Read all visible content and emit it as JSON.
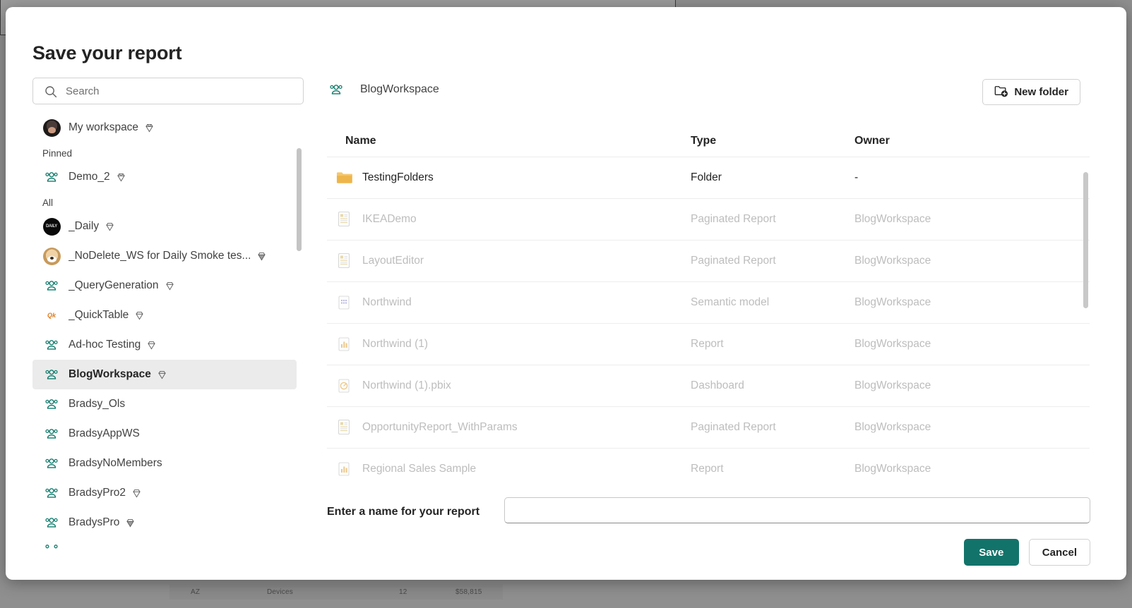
{
  "background": {
    "row_cells": [
      "AZ",
      "Devices",
      "12",
      "$58,815"
    ]
  },
  "dialog": {
    "title": "Save your report"
  },
  "search": {
    "placeholder": "Search",
    "value": "",
    "icon": "search-icon"
  },
  "sidebar": {
    "my_workspace": {
      "label": "My workspace",
      "icon": "avatar-person",
      "badge": "gem-icon"
    },
    "groups": [
      {
        "label": "Pinned",
        "items": [
          {
            "label": "Demo_2",
            "icon": "workspace-group-icon",
            "badge": "gem-icon",
            "selected": false
          }
        ]
      },
      {
        "label": "All",
        "items": [
          {
            "label": "_Daily",
            "icon": "avatar-black",
            "badge": "gem-icon",
            "selected": false
          },
          {
            "label": "_NoDelete_WS for Daily Smoke tes...",
            "icon": "avatar-dog",
            "badge": "gem-dark-icon",
            "selected": false
          },
          {
            "label": "_QueryGeneration",
            "icon": "workspace-group-icon",
            "badge": "gem-icon",
            "selected": false
          },
          {
            "label": "_QuickTable",
            "icon": "avatar-quick",
            "badge": "gem-icon",
            "selected": false
          },
          {
            "label": "Ad-hoc Testing",
            "icon": "workspace-group-icon",
            "badge": "gem-icon",
            "selected": false
          },
          {
            "label": "BlogWorkspace",
            "icon": "workspace-group-icon",
            "badge": "gem-icon",
            "selected": true
          },
          {
            "label": "Bradsy_Ols",
            "icon": "workspace-group-icon",
            "badge": "",
            "selected": false
          },
          {
            "label": "BradsyAppWS",
            "icon": "workspace-group-icon",
            "badge": "",
            "selected": false
          },
          {
            "label": "BradsyNoMembers",
            "icon": "workspace-group-icon",
            "badge": "",
            "selected": false
          },
          {
            "label": "BradsyPro2",
            "icon": "workspace-group-icon",
            "badge": "gem-icon",
            "selected": false
          },
          {
            "label": "BradysPro",
            "icon": "workspace-group-icon",
            "badge": "gem-dark-icon",
            "selected": false
          }
        ]
      }
    ]
  },
  "content": {
    "breadcrumb": {
      "label": "BlogWorkspace",
      "icon": "workspace-group-icon"
    },
    "new_folder_button": {
      "label": "New folder",
      "icon": "new-folder-icon"
    },
    "columns": [
      "Name",
      "Type",
      "Owner"
    ],
    "rows": [
      {
        "name": "TestingFolders",
        "type": "Folder",
        "owner": "-",
        "icon": "folder-icon",
        "disabled": false
      },
      {
        "name": "IKEADemo",
        "type": "Paginated Report",
        "owner": "BlogWorkspace",
        "icon": "paginated-report-icon",
        "disabled": true
      },
      {
        "name": "LayoutEditor",
        "type": "Paginated Report",
        "owner": "BlogWorkspace",
        "icon": "paginated-report-icon",
        "disabled": true
      },
      {
        "name": "Northwind",
        "type": "Semantic model",
        "owner": "BlogWorkspace",
        "icon": "semantic-model-icon",
        "disabled": true
      },
      {
        "name": "Northwind (1)",
        "type": "Report",
        "owner": "BlogWorkspace",
        "icon": "report-icon",
        "disabled": true
      },
      {
        "name": "Northwind (1).pbix",
        "type": "Dashboard",
        "owner": "BlogWorkspace",
        "icon": "dashboard-icon",
        "disabled": true
      },
      {
        "name": "OpportunityReport_WithParams",
        "type": "Paginated Report",
        "owner": "BlogWorkspace",
        "icon": "paginated-report-icon",
        "disabled": true
      },
      {
        "name": "Regional Sales Sample",
        "type": "Report",
        "owner": "BlogWorkspace",
        "icon": "report-icon",
        "disabled": true
      }
    ]
  },
  "footer": {
    "name_label": "Enter a name for your report",
    "name_value": "",
    "name_placeholder": "",
    "save_label": "Save",
    "cancel_label": "Cancel"
  },
  "colors": {
    "accent_green": "#12736a",
    "workspace_icon_teal": "#0f7b6c",
    "folder_yellow": "#f2c14e",
    "selected_row_bg": "#ebebeb",
    "disabled_text": "#bdbdbd"
  }
}
